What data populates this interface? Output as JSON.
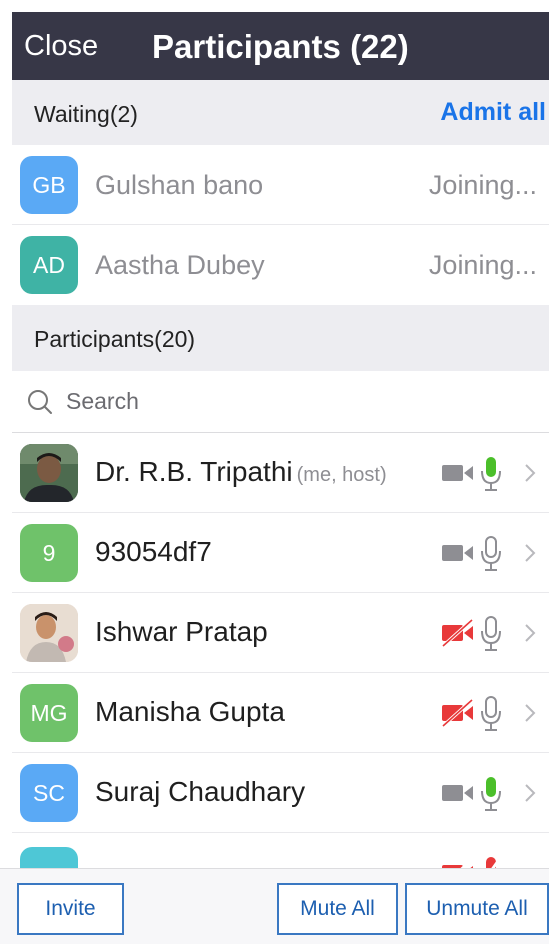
{
  "header": {
    "close_label": "Close",
    "title": "Participants (22)"
  },
  "waiting": {
    "label": "Waiting(2)",
    "admit_all": "Admit all",
    "items": [
      {
        "initials": "GB",
        "name": "Gulshan bano",
        "status": "Joining...",
        "color": "#5aa9f5"
      },
      {
        "initials": "AD",
        "name": "Aastha Dubey",
        "status": "Joining...",
        "color": "#3fb3a5"
      }
    ]
  },
  "participants": {
    "label": "Participants(20)",
    "search_placeholder": "Search",
    "items": [
      {
        "initials": "",
        "avatar": "photo",
        "name": "Dr. R.B. Tripathi",
        "suffix": "(me, host)",
        "video_on": true,
        "audio_on": true
      },
      {
        "initials": "9",
        "name": "93054df7",
        "color": "#6fc26a",
        "video_on": true,
        "audio_on": false
      },
      {
        "initials": "",
        "avatar": "photo",
        "name": "Ishwar Pratap",
        "video_on": false,
        "audio_on": false
      },
      {
        "initials": "MG",
        "name": "Manisha Gupta",
        "color": "#6fc26a",
        "video_on": false,
        "audio_on": false
      },
      {
        "initials": "SC",
        "name": "Suraj Chaudhary",
        "color": "#5aa9f5",
        "video_on": true,
        "audio_on": true
      }
    ]
  },
  "footer": {
    "invite": "Invite",
    "mute_all": "Mute All",
    "unmute_all": "Unmute All"
  },
  "colors": {
    "header_bg": "#373747",
    "accent": "#1a74e8",
    "mic_on": "#4bbf2a",
    "muted_red": "#e8393a",
    "icon_gray": "#8e8e93"
  }
}
